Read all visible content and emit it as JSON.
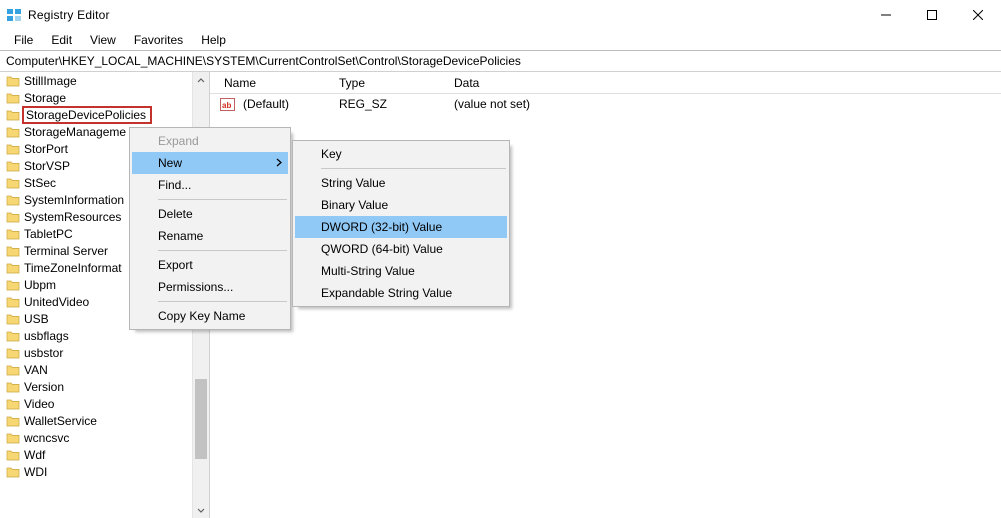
{
  "window": {
    "title": "Registry Editor"
  },
  "menubar": [
    "File",
    "Edit",
    "View",
    "Favorites",
    "Help"
  ],
  "address": "Computer\\HKEY_LOCAL_MACHINE\\SYSTEM\\CurrentControlSet\\Control\\StorageDevicePolicies",
  "tree": [
    "StillImage",
    "Storage",
    "StorageDevicePolicies",
    "StorageManageme",
    "StorPort",
    "StorVSP",
    "StSec",
    "SystemInformation",
    "SystemResources",
    "TabletPC",
    "Terminal Server",
    "TimeZoneInformat",
    "Ubpm",
    "UnitedVideo",
    "USB",
    "usbflags",
    "usbstor",
    "VAN",
    "Version",
    "Video",
    "WalletService",
    "wcncsvc",
    "Wdf",
    "WDI"
  ],
  "tree_selected_index": 2,
  "values": {
    "columns": [
      "Name",
      "Type",
      "Data"
    ],
    "rows": [
      {
        "name": "(Default)",
        "type": "REG_SZ",
        "data": "(value not set)"
      }
    ]
  },
  "context_menu": {
    "expand": "Expand",
    "new": "New",
    "find": "Find...",
    "delete": "Delete",
    "rename": "Rename",
    "export": "Export",
    "permissions": "Permissions...",
    "copy_key_name": "Copy Key Name"
  },
  "new_submenu": [
    "Key",
    "String Value",
    "Binary Value",
    "DWORD (32-bit) Value",
    "QWORD (64-bit) Value",
    "Multi-String Value",
    "Expandable String Value"
  ],
  "new_submenu_hover_index": 3
}
